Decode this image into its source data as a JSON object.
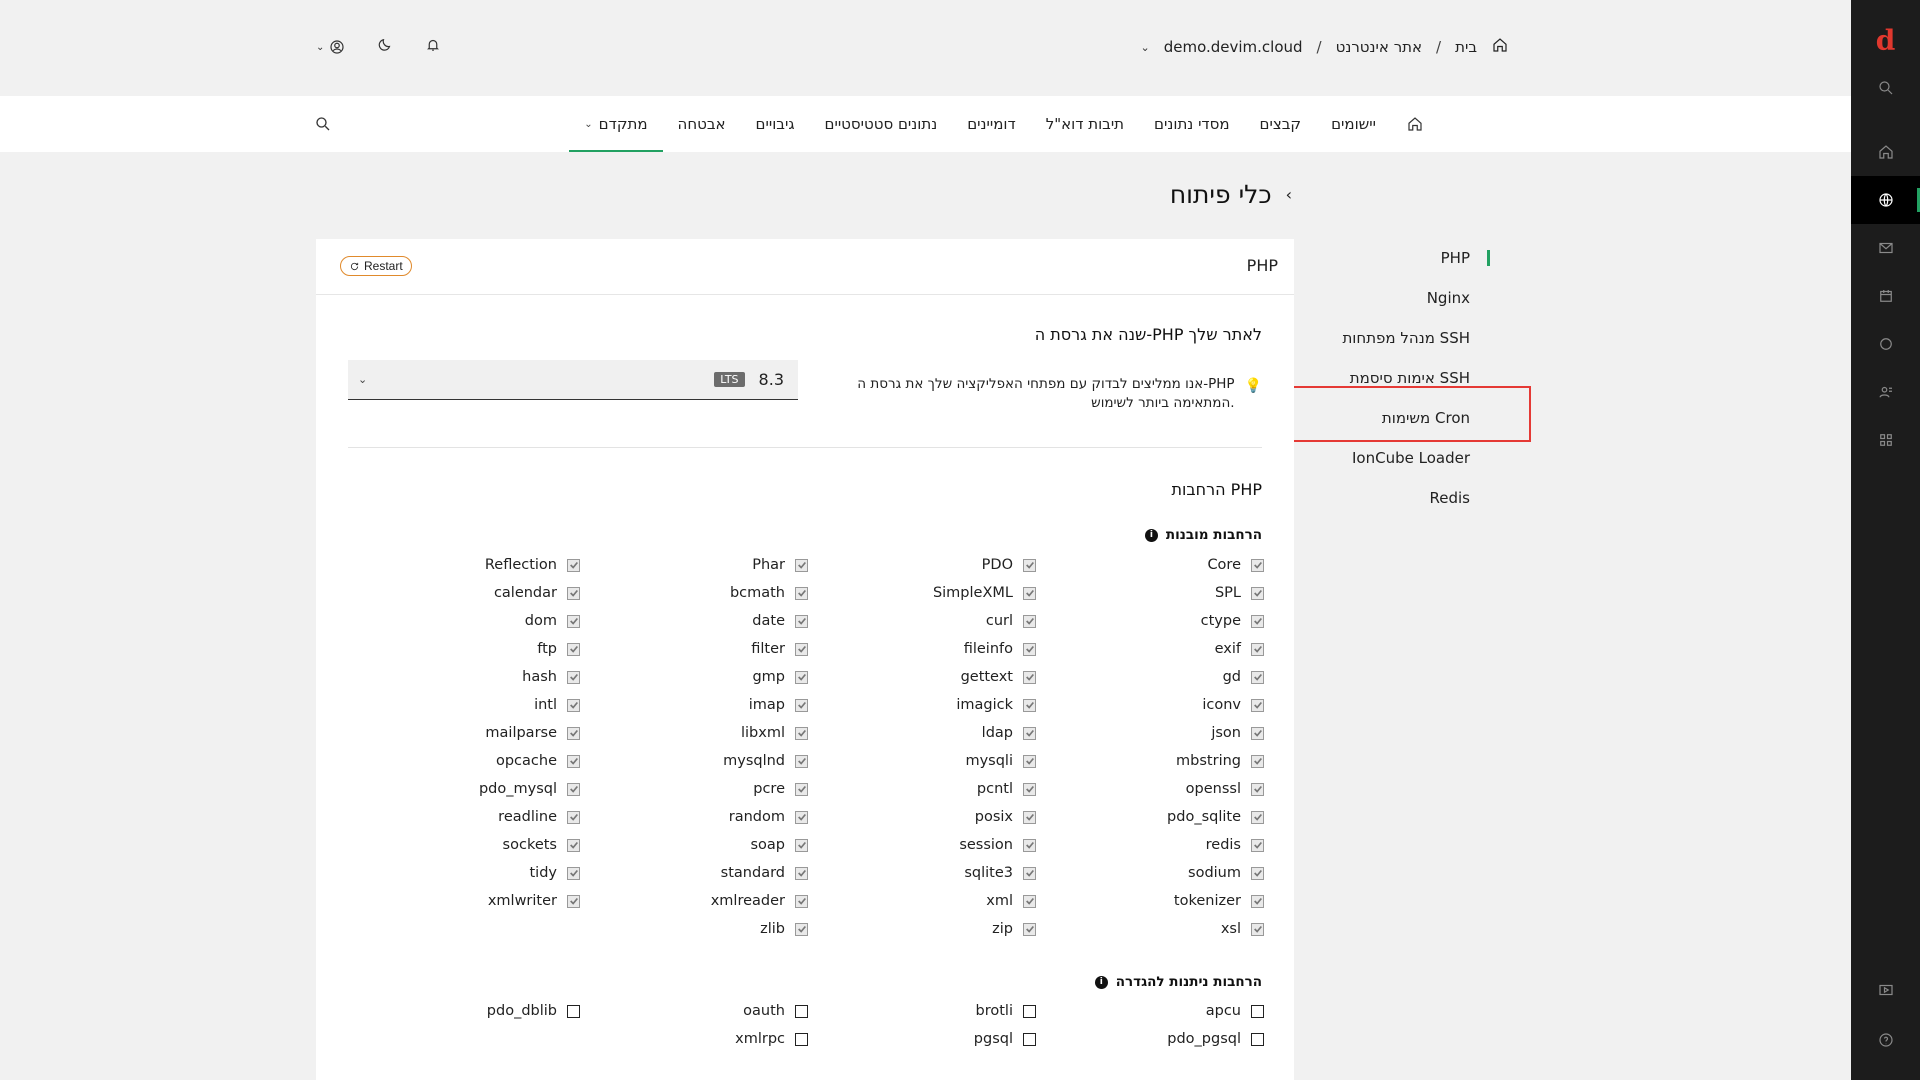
{
  "rail": {
    "logo": "d",
    "icons": [
      "search-icon",
      "home-icon",
      "globe-icon",
      "mail-icon",
      "calendar-icon",
      "circle-icon",
      "users-icon",
      "apps-icon",
      "media-icon",
      "help-icon"
    ]
  },
  "breadcrumb": {
    "home": "בית",
    "section": "אתר אינטרנט",
    "site": "demo.devim.cloud"
  },
  "nav": {
    "items": [
      "יישומים",
      "קבצים",
      "מסדי נתונים",
      "תיבות דוא\"ל",
      "דומיינים",
      "נתונים סטטיסטיים",
      "גיבויים",
      "אבטחה",
      "מתקדם"
    ],
    "active": "מתקדם"
  },
  "page": {
    "title": "כלי פיתוח"
  },
  "side_menu": {
    "items": [
      "PHP",
      "Nginx",
      "מנהל מפתחות SSH",
      "אימות סיסמת SSH",
      "משימות Cron",
      "IonCube Loader",
      "Redis"
    ],
    "active": "PHP"
  },
  "card": {
    "title": "PHP",
    "restart_label": "Restart",
    "version_section": "שנה את גרסת ה-PHP לאתר שלך",
    "version_value": "8.3",
    "version_badge": "LTS",
    "tip": "אנו ממליצים לבדוק עם מפתחי האפליקציה שלך את גרסת ה-PHP המתאימה ביותר לשימוש.",
    "extensions_section": "הרחבות PHP",
    "builtin_head": "הרחבות מובנות",
    "builtin": [
      [
        "Core",
        "PDO",
        "Phar",
        "Reflection"
      ],
      [
        "SPL",
        "SimpleXML",
        "bcmath",
        "calendar"
      ],
      [
        "ctype",
        "curl",
        "date",
        "dom"
      ],
      [
        "exif",
        "fileinfo",
        "filter",
        "ftp"
      ],
      [
        "gd",
        "gettext",
        "gmp",
        "hash"
      ],
      [
        "iconv",
        "imagick",
        "imap",
        "intl"
      ],
      [
        "json",
        "ldap",
        "libxml",
        "mailparse"
      ],
      [
        "mbstring",
        "mysqli",
        "mysqlnd",
        "opcache"
      ],
      [
        "openssl",
        "pcntl",
        "pcre",
        "pdo_mysql"
      ],
      [
        "pdo_sqlite",
        "posix",
        "random",
        "readline"
      ],
      [
        "redis",
        "session",
        "soap",
        "sockets"
      ],
      [
        "sodium",
        "sqlite3",
        "standard",
        "tidy"
      ],
      [
        "tokenizer",
        "xml",
        "xmlreader",
        "xmlwriter"
      ],
      [
        "xsl",
        "zip",
        "zlib",
        ""
      ]
    ],
    "installable_head": "הרחבות ניתנות להגדרה",
    "installable": [
      [
        "apcu",
        "brotli",
        "oauth",
        "pdo_dblib"
      ],
      [
        "pdo_pgsql",
        "pgsql",
        "xmlrpc",
        ""
      ]
    ]
  }
}
